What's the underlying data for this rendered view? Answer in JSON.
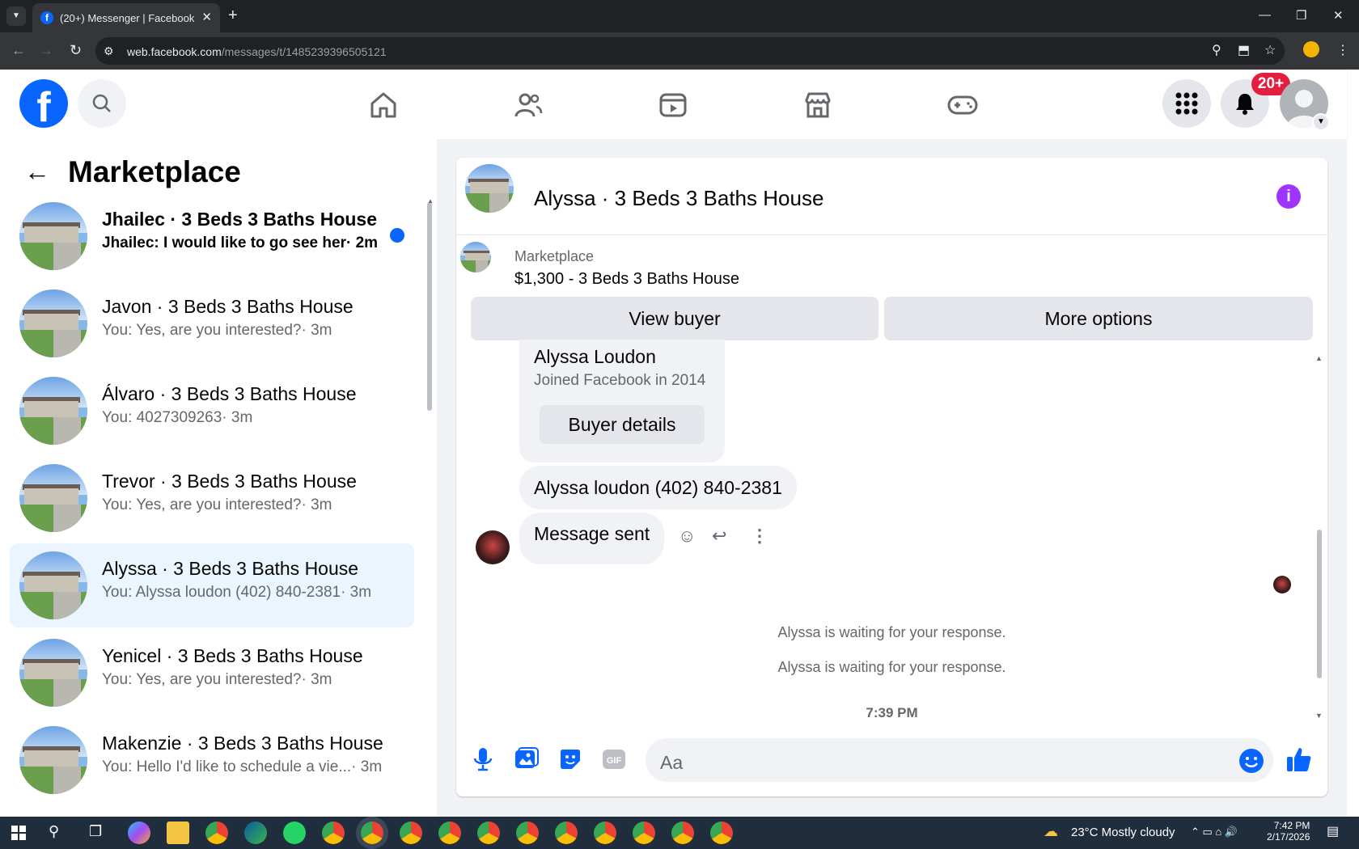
{
  "browser": {
    "tab_title": "(20+) Messenger | Facebook",
    "url_host": "web.facebook.com",
    "url_path": "/messages/t/1485239396505121"
  },
  "fb_header": {
    "notification_badge": "20+"
  },
  "left_pane": {
    "title": "Marketplace",
    "conversations": [
      {
        "name": "Jhailec · 3 Beds 3 Baths House",
        "preview": "Jhailec: I would like to go see her",
        "time": "· 2m",
        "unread": true
      },
      {
        "name": "Javon · 3 Beds 3 Baths House",
        "preview": "You: Yes, are you interested?",
        "time": "· 3m"
      },
      {
        "name": "Álvaro · 3 Beds 3 Baths House",
        "preview": "You: 4027309263",
        "time": "· 3m"
      },
      {
        "name": "Trevor · 3 Beds 3 Baths House",
        "preview": "You: Yes, are you interested?",
        "time": "· 3m"
      },
      {
        "name": "Alyssa · 3 Beds 3 Baths House",
        "preview": "You: Alyssa loudon (402) 840-2381",
        "time": "· 3m",
        "active": true
      },
      {
        "name": "Yenicel · 3 Beds 3 Baths House",
        "preview": "You: Yes, are you interested?",
        "time": "· 3m"
      },
      {
        "name": "Makenzie · 3 Beds 3 Baths House",
        "preview": "You: Hello I'd like to schedule a vie...",
        "time": "· 3m"
      }
    ]
  },
  "chat": {
    "title": "Alyssa · 3 Beds 3 Baths House",
    "listing_label": "Marketplace",
    "listing_price": "$1,300 - 3 Beds 3 Baths House",
    "view_buyer": "View buyer",
    "more_options": "More options",
    "buyer_name": "Alyssa Loudon",
    "buyer_joined": "Joined Facebook in 2014",
    "buyer_details": "Buyer details",
    "message_1": "Alyssa loudon (402) 840-2381",
    "message_2": "Message sent",
    "waiting_1": "Alyssa is waiting for your response.",
    "waiting_2": "Alyssa is waiting for your response.",
    "timestamp": "7:39 PM",
    "composer_placeholder": "Aa"
  },
  "taskbar": {
    "weather": "23°C  Mostly cloudy",
    "time": "7:42 PM",
    "date": "2/17/2026"
  },
  "colors": {
    "fb_blue": "#0866ff",
    "active_row": "#ebf5ff",
    "badge_red": "#e41e3f",
    "info_purple": "#a033ff"
  }
}
